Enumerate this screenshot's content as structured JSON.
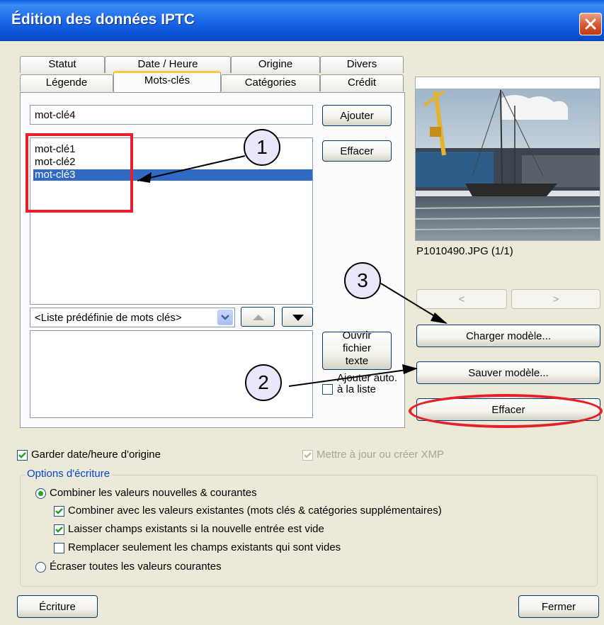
{
  "window": {
    "title": "Édition des données IPTC"
  },
  "tabs": {
    "row_back": [
      "Statut",
      "Date / Heure",
      "Origine",
      "Divers"
    ],
    "row_front": [
      "Légende",
      "Mots-clés",
      "Catégories",
      "Crédit"
    ],
    "active": "Mots-clés"
  },
  "keywords": {
    "input_value": "mot-clé4",
    "add_label": "Ajouter",
    "delete_label": "Effacer",
    "items": [
      "mot-clé1",
      "mot-clé2",
      "mot-clé3"
    ],
    "selected": "mot-clé3",
    "predefined_value": "<Liste prédéfinie de mots clés>",
    "open_text_file_label": "Ouvrir fichier texte",
    "auto_add_label": "Ajouter auto. à la liste"
  },
  "preview": {
    "filename": "P1010490.JPG (1/1)",
    "prev_label": "<",
    "next_label": ">",
    "load_template_label": "Charger modèle...",
    "save_template_label": "Sauver modèle...",
    "clear_label": "Effacer"
  },
  "callouts": [
    "1",
    "2",
    "3"
  ],
  "options": {
    "keep_date_label": "Garder date/heure d'origine",
    "keep_date_checked": true,
    "xmp_label": "Mettre à jour ou créer XMP",
    "xmp_checked": true,
    "group_title": "Options d'écriture",
    "combine_label": "Combiner les valeurs nouvelles & courantes",
    "combine_existing_label": "Combiner avec les valeurs existantes (mots clés & catégories supplémentaires)",
    "keep_existing_label": "Laisser champs existants si la nouvelle entrée est vide",
    "replace_empty_label": "Remplacer seulement les champs existants qui sont vides",
    "overwrite_label": "Écraser toutes les valeurs courantes"
  },
  "footer": {
    "write_label": "Écriture",
    "close_label": "Fermer"
  },
  "colors": {
    "title_bar": "#0B54D6",
    "selection": "#316AC5",
    "annotation": "#E5202A",
    "active_tab": "#FFC83C"
  }
}
